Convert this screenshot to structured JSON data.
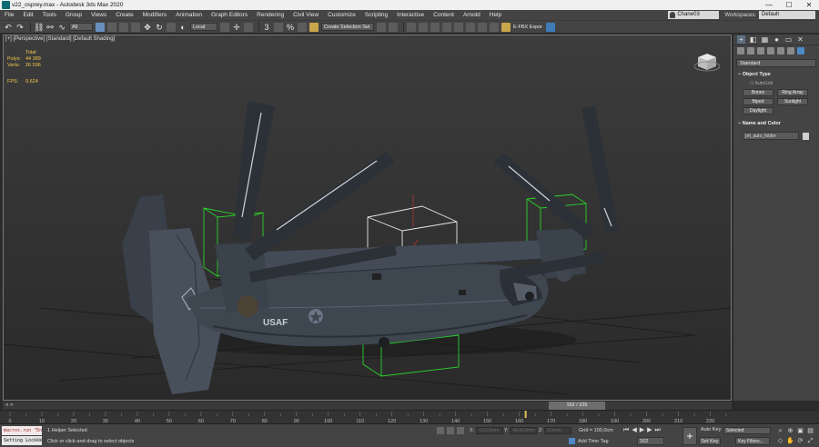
{
  "window": {
    "title": "v22_osprey.max - Autodesk 3ds Max 2020",
    "controls": [
      "—",
      "☐",
      "✕"
    ]
  },
  "menu": {
    "items": [
      "File",
      "Edit",
      "Tools",
      "Group",
      "Views",
      "Create",
      "Modifiers",
      "Animation",
      "Graph Editors",
      "Rendering",
      "Civil View",
      "Customize",
      "Scripting",
      "Interactive",
      "Content",
      "Arnold",
      "Help"
    ],
    "user": "Chane03",
    "workspaces_label": "Workspaces:",
    "workspace": "Default"
  },
  "toolbar": {
    "filter": "All",
    "coord_system": "Local",
    "selection_set": "Create Selection Set",
    "fbx": "E-FBX Expor"
  },
  "viewport": {
    "label": "[+] [Perspective] [Standard] [Default Shading]",
    "stats": {
      "total": "Total",
      "polys_label": "Polys:",
      "polys": "44 389",
      "verts_label": "Verts:",
      "verts": "26 596",
      "fps_label": "FPS:",
      "fps": "0,624"
    },
    "fuselage_text": "USAF"
  },
  "command_panel": {
    "category": "Standard",
    "object_type_title": "Object Type",
    "autogrid": "AutoGrid",
    "buttons": [
      "Bones",
      "Ring Array",
      "Biped",
      "Sunlight",
      "Daylight"
    ],
    "name_color_title": "Name and Color",
    "name_value": "prt_auto_folder"
  },
  "timeline": {
    "frame_readout": "162 / 225",
    "ruler_labels": [
      "0",
      "10",
      "20",
      "30",
      "40",
      "50",
      "60",
      "70",
      "80",
      "90",
      "100",
      "110",
      "120",
      "130",
      "140",
      "150",
      "160",
      "170",
      "180",
      "190",
      "200",
      "210",
      "220"
    ],
    "left_arrows": "« »"
  },
  "status": {
    "listener_line1": "macros.run \"En",
    "listener_line2": "Setting Lockkk",
    "selection": "1 Helper Selected",
    "hint": "Click or click-and-drag to select objects",
    "x_label": "X:",
    "x_value": "-218,0mm",
    "y_label": "Y:",
    "y_value": "46,413mm",
    "z_label": "Z:",
    "z_value": "0,0mm",
    "grid": "Grid = 100,0cm",
    "add_time_tag": "Add Time Tag",
    "frame": "162",
    "auto_key": "Auto Key",
    "selected": "Selected",
    "set_key": "Set Key",
    "key_filters": "Key Filters..."
  }
}
